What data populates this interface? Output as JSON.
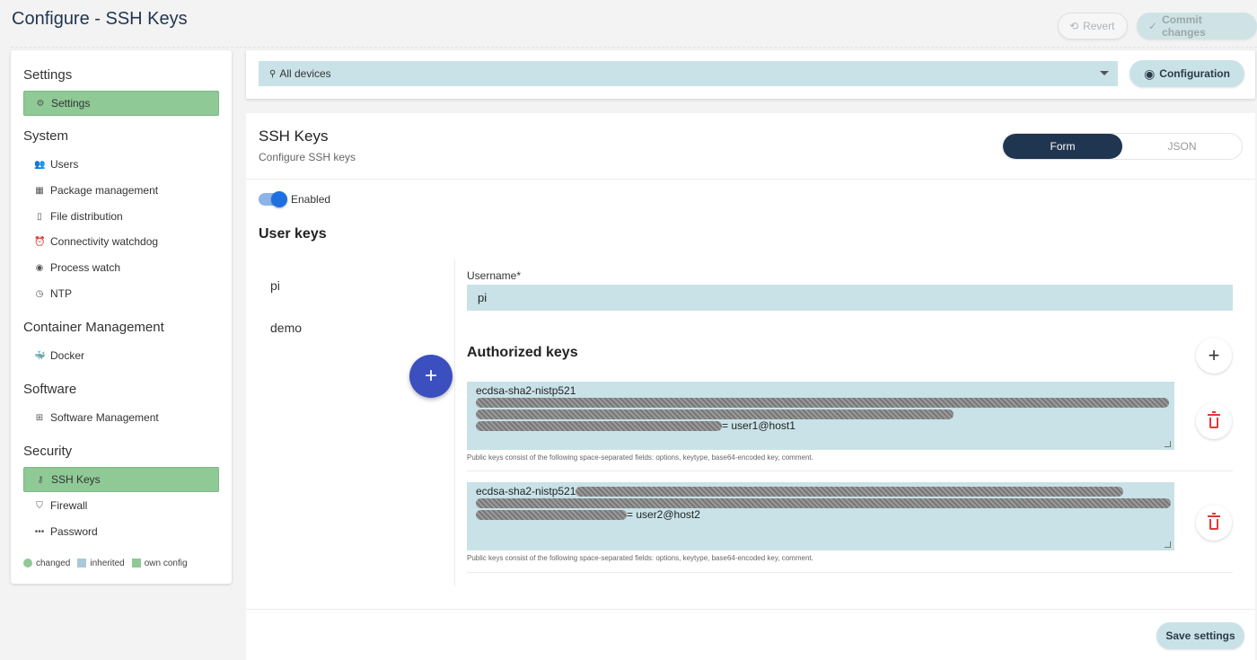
{
  "page": {
    "title": "Configure - SSH Keys"
  },
  "toolbar": {
    "revert_label": "Revert",
    "commit_label": "Commit changes"
  },
  "sidebar": {
    "sections": [
      {
        "title": "Settings",
        "items": [
          {
            "label": "Settings",
            "icon": "gear-icon",
            "active": true
          }
        ]
      },
      {
        "title": "System",
        "items": [
          {
            "label": "Users",
            "icon": "users-icon"
          },
          {
            "label": "Package management",
            "icon": "grid-icon"
          },
          {
            "label": "File distribution",
            "icon": "file-icon"
          },
          {
            "label": "Connectivity watchdog",
            "icon": "alarm-icon"
          },
          {
            "label": "Process watch",
            "icon": "eye-icon"
          },
          {
            "label": "NTP",
            "icon": "clock-icon"
          }
        ]
      },
      {
        "title": "Container Management",
        "items": [
          {
            "label": "Docker",
            "icon": "docker-icon"
          }
        ]
      },
      {
        "title": "Software",
        "items": [
          {
            "label": "Software Management",
            "icon": "apps-icon"
          }
        ]
      },
      {
        "title": "Security",
        "items": [
          {
            "label": "SSH Keys",
            "icon": "key-icon",
            "active": true
          },
          {
            "label": "Firewall",
            "icon": "shield-icon"
          },
          {
            "label": "Password",
            "icon": "password-icon"
          }
        ]
      }
    ],
    "legend": {
      "changed": "changed",
      "inherited": "inherited",
      "own": "own config"
    }
  },
  "device": {
    "selected": "All devices",
    "config_button": "Configuration"
  },
  "main": {
    "title": "SSH Keys",
    "subtitle": "Configure SSH keys",
    "toggle": {
      "form": "Form",
      "json": "JSON"
    },
    "enabled_label": "Enabled",
    "user_keys_heading": "User keys",
    "users": [
      "pi",
      "demo"
    ],
    "username_label": "Username*",
    "username_value": "pi",
    "authorized_heading": "Authorized keys",
    "keys": [
      {
        "prefix": "ecdsa-sha2-nistp521",
        "suffix": "= user1@host1"
      },
      {
        "prefix": "ecdsa-sha2-nistp521",
        "suffix": "= user2@host2"
      }
    ],
    "hint": "Public keys consist of the following space-separated fields: options, keytype, base64-encoded key, comment.",
    "save_label": "Save settings"
  },
  "colors": {
    "accent": "#1f3550",
    "active_green": "#8fc996",
    "field_bg": "#c9e2e8",
    "fab": "#3b4fbe",
    "danger": "#e53935"
  }
}
